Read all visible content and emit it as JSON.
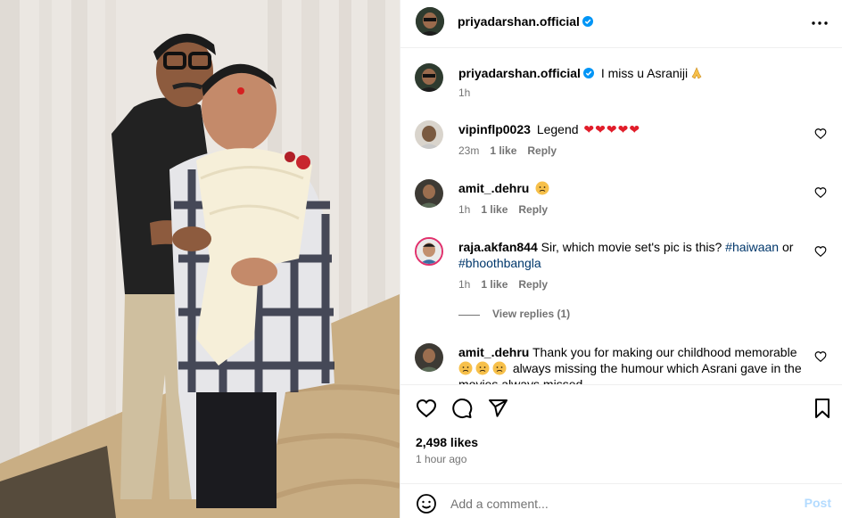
{
  "post": {
    "author": "priyadarshan.official",
    "caption_author": "priyadarshan.official",
    "caption_text": "I miss u Asraniji",
    "caption_time": "1h",
    "likes_text": "2,498 likes",
    "time_ago": "1 hour ago"
  },
  "comments": [
    {
      "username": "vipinflp0023",
      "text": "Legend",
      "time": "23m",
      "likes": "1 like",
      "reply": "Reply"
    },
    {
      "username": "amit_.dehru",
      "text": "",
      "time": "1h",
      "likes": "1 like",
      "reply": "Reply"
    },
    {
      "username": "raja.akfan844",
      "text": "Sir, which movie set's pic is this?",
      "tag1": "#haiwaan",
      "connector": "or",
      "tag2": "#bhoothbangla",
      "time": "1h",
      "likes": "1 like",
      "reply": "Reply"
    },
    {
      "username": "amit_.dehru",
      "text_a": "Thank you for making our childhood memorable",
      "text_b": "always missing the humour which Asrani gave in the",
      "text_c": "movies always missed",
      "time": "",
      "likes": "",
      "reply": ""
    }
  ],
  "view_replies": "View replies (1)",
  "composer": {
    "placeholder": "Add a comment...",
    "post_label": "Post"
  },
  "icons": {
    "verified": "verified-badge-icon",
    "more": "more-options-icon",
    "like": "heart-icon",
    "comment": "comment-icon",
    "share": "share-icon",
    "save": "bookmark-icon",
    "emoji": "emoji-icon"
  },
  "colors": {
    "link": "#00376b",
    "verified": "#0095f6",
    "heart": "#ff3040",
    "muted": "#737373",
    "post_disabled": "#b3dbff"
  }
}
